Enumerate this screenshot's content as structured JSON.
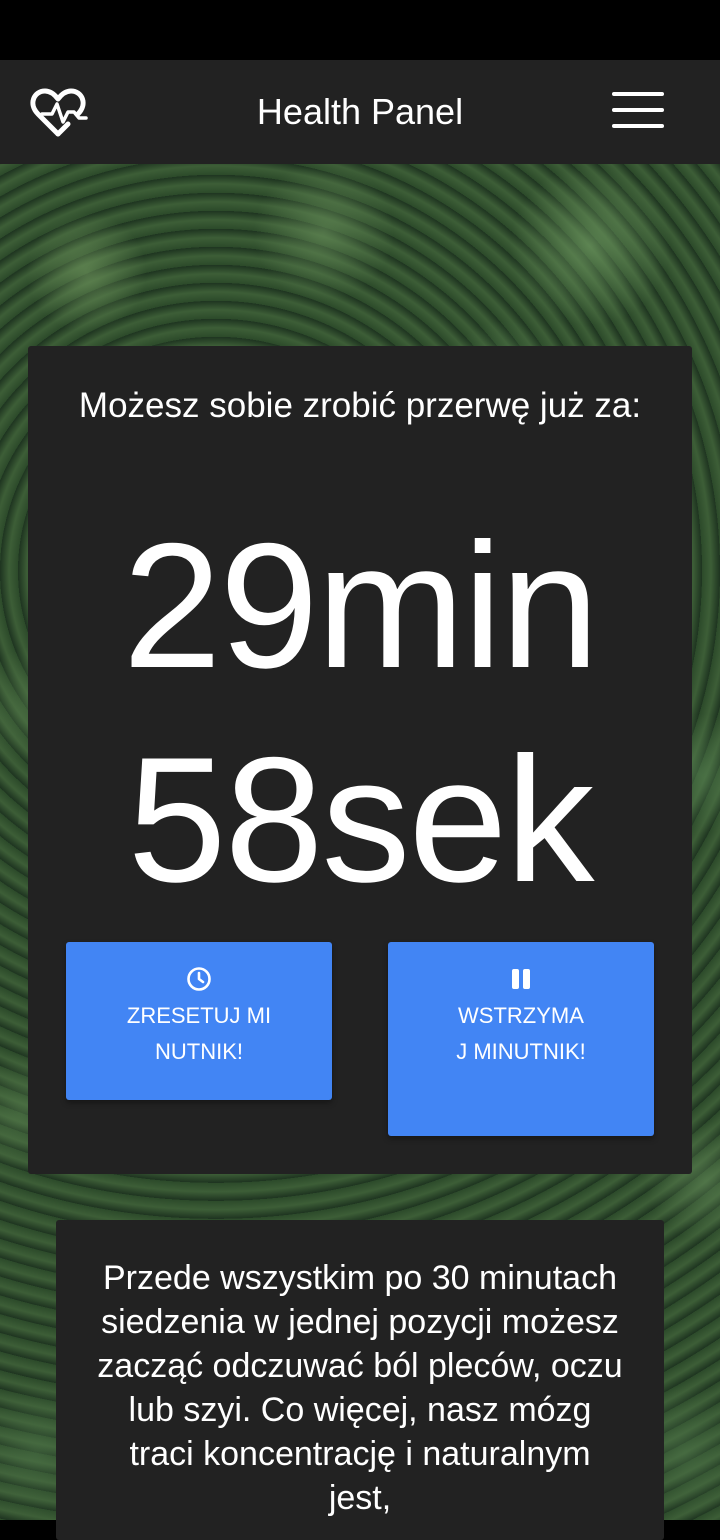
{
  "header": {
    "title": "Health Panel",
    "logo_icon": "heart-pulse-icon",
    "menu_icon": "hamburger-menu-icon"
  },
  "timer": {
    "heading": "Możesz sobie zrobić przerwę już za:",
    "minutes": "29min",
    "seconds": "58sek"
  },
  "buttons": {
    "reset": {
      "label": "ZRESETUJ MINUTNIK!",
      "icon": "clock-icon"
    },
    "pause": {
      "label": "WSTRZYMAJ MINUTNIK!",
      "icon": "pause-icon"
    }
  },
  "info": {
    "text": "Przede wszystkim po 30 minutach siedzenia w jednej pozycji możesz zacząć odczuwać ból pleców, oczu lub szyi. Co więcej, nasz mózg traci koncentrację i naturalnym jest,"
  },
  "colors": {
    "navbar": "#222222",
    "card": "#222222",
    "button": "#4285f4",
    "text": "#ffffff"
  }
}
